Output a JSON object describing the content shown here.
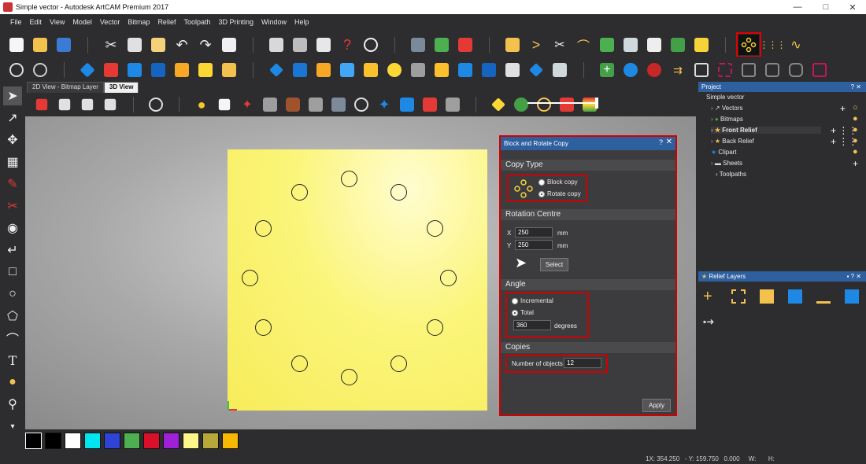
{
  "window": {
    "title": "Simple vector - Autodesk ArtCAM Premium 2017",
    "controls": [
      "minimize",
      "maximize",
      "close"
    ]
  },
  "menu": [
    "File",
    "Edit",
    "View",
    "Model",
    "Vector",
    "Bitmap",
    "Relief",
    "Toolpath",
    "3D Printing",
    "Window",
    "Help"
  ],
  "doc_tabs": [
    {
      "label": "2D View - Bitmap Layer",
      "active": false
    },
    {
      "label": "3D View",
      "active": true
    }
  ],
  "dialog": {
    "title": "Block and Rotate Copy",
    "help": "?",
    "close": "✕",
    "copy_type": {
      "heading": "Copy Type",
      "options": [
        "Block copy",
        "Rotate copy"
      ],
      "selected": "Rotate copy"
    },
    "rotation_centre": {
      "heading": "Rotation Centre",
      "x_label": "X",
      "x_value": "250",
      "y_label": "Y",
      "y_value": "250",
      "unit": "mm",
      "select_label": "Select"
    },
    "angle": {
      "heading": "Angle",
      "options": [
        "Incremental",
        "Total"
      ],
      "selected": "Total",
      "value": "360",
      "unit": "degrees"
    },
    "copies": {
      "heading": "Copies",
      "label": "Number of objects",
      "value": "12"
    },
    "apply_label": "Apply"
  },
  "project_panel": {
    "title": "Project",
    "root": "Simple vector",
    "items": [
      "Vectors",
      "Bitmaps",
      "Front Relief",
      "Back Relief",
      "Clipart",
      "Sheets",
      "Toolpaths"
    ]
  },
  "relief_layers_panel": {
    "title": "Relief Layers"
  },
  "palette": {
    "colors": [
      "#000000",
      "#ffffff",
      "#00e5f0",
      "#2f44d6",
      "#4cb050",
      "#d8102a",
      "#a020d8",
      "#fff68a",
      "#b8a83a",
      "#f6b800"
    ]
  },
  "status": {
    "x": "354.250",
    "y": "159.750",
    "z": "0.000",
    "w": "",
    "h": ""
  },
  "canvas": {
    "circle_count": 12
  }
}
